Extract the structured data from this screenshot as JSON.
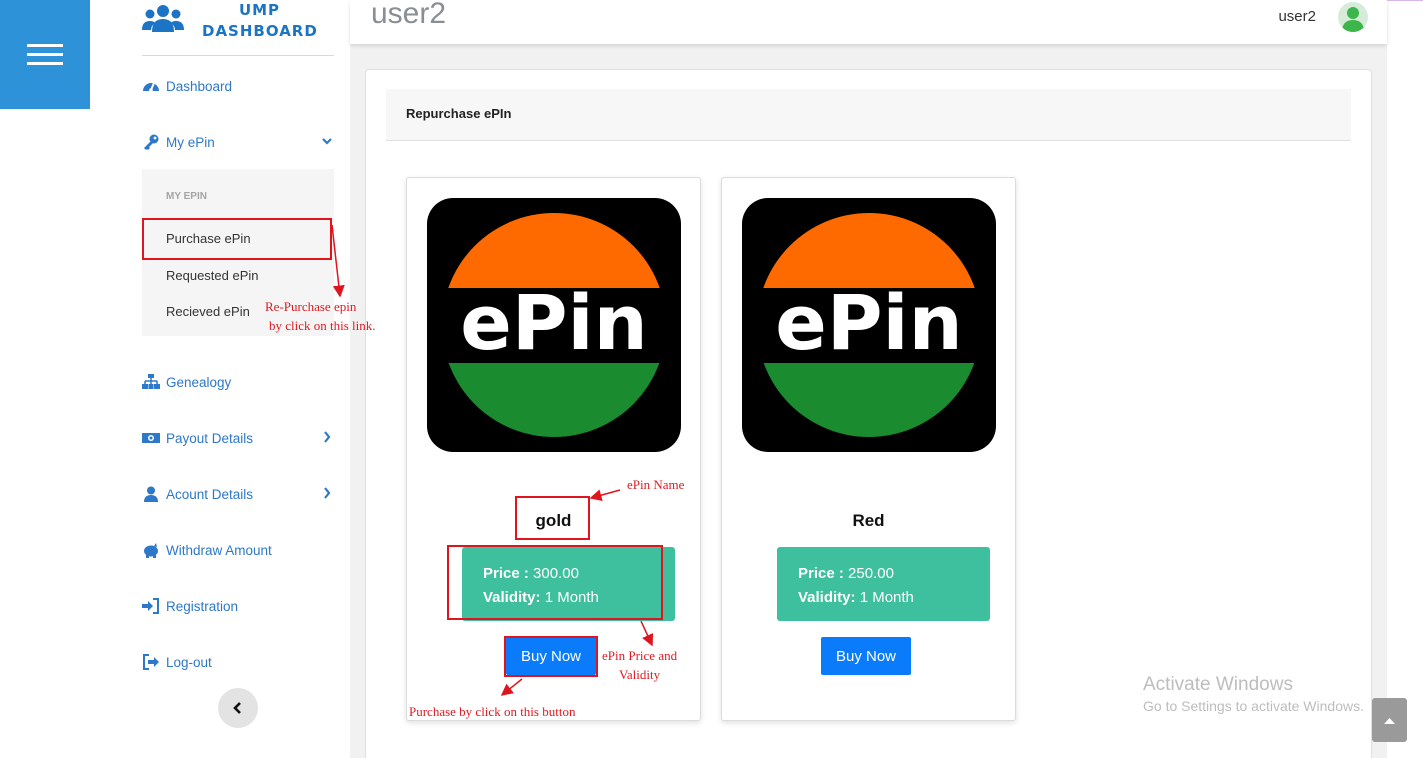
{
  "brand": {
    "line1": "UMP",
    "line2": "DASHBOARD"
  },
  "topbar": {
    "page_title": "user2",
    "username": "user2"
  },
  "sidebar": {
    "dashboard": "Dashboard",
    "my_epin": "My ePin",
    "submenu": {
      "header": "MY EPIN",
      "items": [
        "Purchase ePin",
        "Requested ePin",
        "Recieved ePin"
      ]
    },
    "genealogy": "Genealogy",
    "payout_details": "Payout Details",
    "account_details": "Acount Details",
    "withdraw_amount": "Withdraw Amount",
    "registration": "Registration",
    "logout": "Log-out"
  },
  "main": {
    "card_title": "Repurchase ePIn",
    "products": [
      {
        "logo_text": "ePin",
        "name": "gold",
        "price_label": "Price :",
        "price": "300.00",
        "validity_label": "Validity:",
        "validity": "1 Month",
        "button": "Buy Now"
      },
      {
        "logo_text": "ePin",
        "name": "Red",
        "price_label": "Price :",
        "price": "250.00",
        "validity_label": "Validity:",
        "validity": "1 Month",
        "button": "Buy Now"
      }
    ]
  },
  "annotations": {
    "repurchase_line1": "Re-Purchase epin",
    "repurchase_line2": "by click on this link.",
    "epin_name": "ePin Name",
    "price_line1": "ePin Price and",
    "price_line2": "Validity",
    "purchase_button": "Purchase by click on this button"
  },
  "watermark": {
    "line1": "Activate Windows",
    "line2": "Go to Settings to activate Windows."
  },
  "colors": {
    "accent_blue": "#2d92d8",
    "price_green": "#3ebf9e",
    "buy_blue": "#0a7cfb",
    "annotation_red": "#e0141e",
    "logo_orange": "#ff6a00",
    "logo_green": "#1a8b2e"
  }
}
